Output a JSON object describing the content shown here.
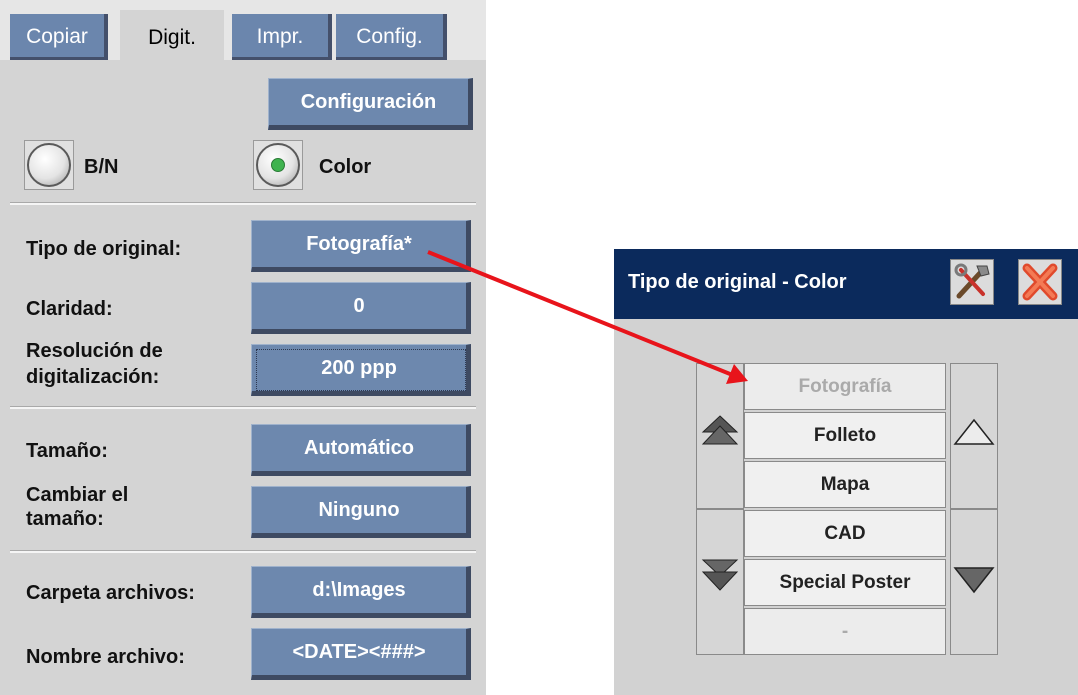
{
  "tabs": [
    {
      "label": "Copiar"
    },
    {
      "label": "Digit."
    },
    {
      "label": "Impr."
    },
    {
      "label": "Config."
    }
  ],
  "config_button": "Configuración",
  "color_mode": {
    "bw_label": "B/N",
    "color_label": "Color",
    "selected": "Color"
  },
  "settings": {
    "original_type": {
      "label": "Tipo de original:",
      "value": "Fotografía*"
    },
    "brightness": {
      "label": "Claridad:",
      "value": "0"
    },
    "resolution": {
      "label_line1": "Resolución de",
      "label_line2": "digitalización:",
      "value": "200 ppp"
    },
    "size": {
      "label": "Tamaño:",
      "value": "Automático"
    },
    "resize": {
      "label_line1": "Cambiar el",
      "label_line2": "tamaño:",
      "value": "Ninguno"
    },
    "folder": {
      "label": "Carpeta archivos:",
      "value": "d:\\Images"
    },
    "filename": {
      "label": "Nombre archivo:",
      "value": "<DATE><###>"
    }
  },
  "dialog": {
    "title": "Tipo de original - Color",
    "items": [
      "Fotografía",
      "Folleto",
      "Mapa",
      "CAD",
      "Special Poster",
      "-"
    ],
    "selected_item": "Fotografía"
  },
  "colors": {
    "button": "#6d88ae",
    "dialog_title_bg": "#0b2a5c",
    "arrow": "#e8141b",
    "radio_selected": "#3fb34f"
  }
}
